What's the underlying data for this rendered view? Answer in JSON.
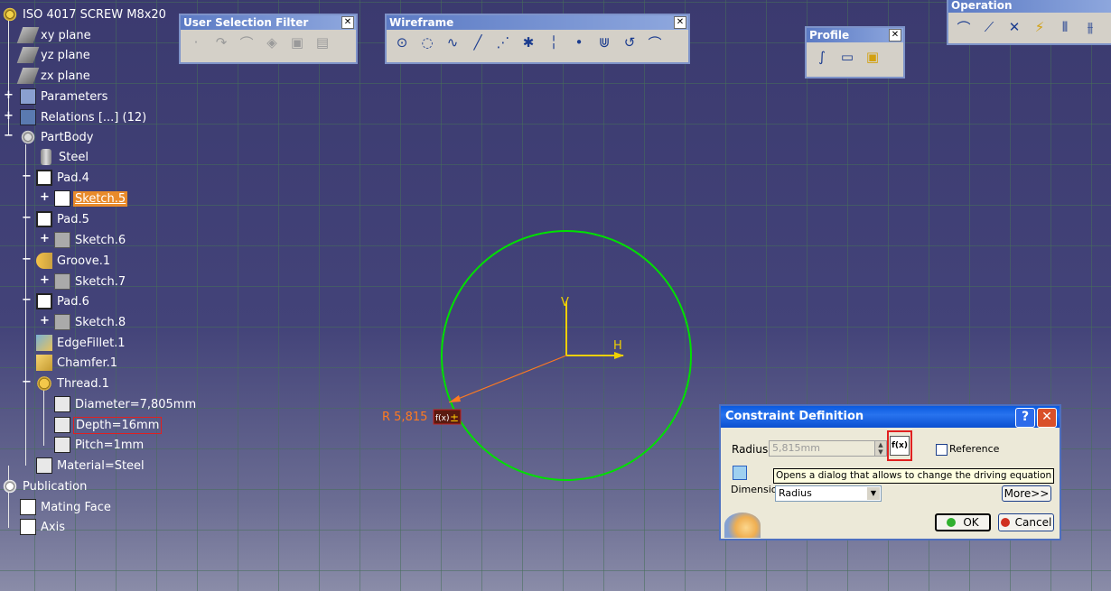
{
  "tree": {
    "root": "ISO 4017 SCREW M8x20",
    "items": [
      {
        "label": "xy plane"
      },
      {
        "label": "yz plane"
      },
      {
        "label": "zx plane"
      },
      {
        "label": "Parameters"
      },
      {
        "label": "Relations [...] (12)"
      },
      {
        "label": "PartBody"
      },
      {
        "label": "Steel"
      },
      {
        "label": "Pad.4"
      },
      {
        "label": "Sketch.5"
      },
      {
        "label": "Pad.5"
      },
      {
        "label": "Sketch.6"
      },
      {
        "label": "Groove.1"
      },
      {
        "label": "Sketch.7"
      },
      {
        "label": "Pad.6"
      },
      {
        "label": "Sketch.8"
      },
      {
        "label": "EdgeFillet.1"
      },
      {
        "label": "Chamfer.1"
      },
      {
        "label": "Thread.1"
      },
      {
        "label": "Diameter=7,805mm"
      },
      {
        "label": "Depth=16mm"
      },
      {
        "label": "Pitch=1mm"
      },
      {
        "label": "Material=Steel"
      },
      {
        "label": "Publication"
      },
      {
        "label": "Mating Face"
      },
      {
        "label": "Axis"
      }
    ]
  },
  "toolbars": {
    "user_selection_filter": {
      "title": "User Selection Filter"
    },
    "wireframe": {
      "title": "Wireframe"
    },
    "profile": {
      "title": "Profile"
    },
    "operation": {
      "title": "Operation"
    }
  },
  "sketch": {
    "axis_v": "V",
    "axis_h": "H",
    "radius_label": "R 5,815",
    "circle_color": "#00e000",
    "axis_color": "#f0d000",
    "dimension_color": "#ff7a20"
  },
  "dialog": {
    "title": "Constraint Definition",
    "help": "?",
    "close": "✕",
    "radius_label": "Radius",
    "radius_value": "5,815mm",
    "fx_label": "f(x)",
    "reference_label": "Reference",
    "tooltip": "Opens a dialog that allows to change the driving equation",
    "dimension_label": "Dimension",
    "dimension_value": "Radius",
    "more_label": "More>>",
    "ok_label": "OK",
    "cancel_label": "Cancel"
  }
}
